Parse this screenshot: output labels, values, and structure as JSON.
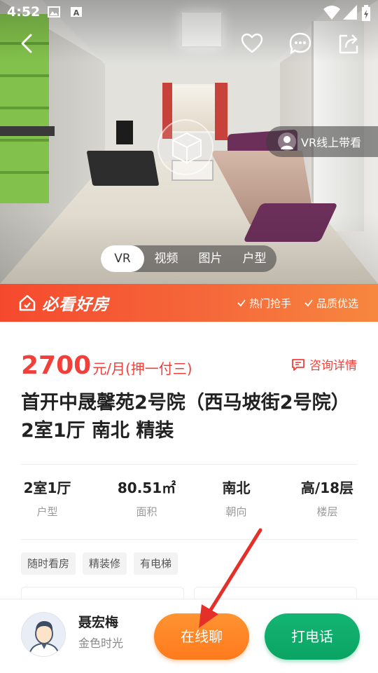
{
  "status_bar": {
    "time": "4:52",
    "icons": [
      "gallery-icon",
      "a-icon",
      "wifi-icon",
      "signal-icon",
      "battery-icon"
    ]
  },
  "hero": {
    "nav_icons": [
      "back-icon",
      "heart-icon",
      "message-icon",
      "share-icon"
    ],
    "vr_guide_label": "VR线上带看",
    "media_tabs": [
      {
        "label": "VR",
        "active": true
      },
      {
        "label": "视频",
        "active": false
      },
      {
        "label": "图片",
        "active": false
      },
      {
        "label": "户型",
        "active": false
      }
    ]
  },
  "banner": {
    "title": "必看好房",
    "tags": [
      "热门抢手",
      "品质优选"
    ],
    "colors": {
      "from": "#f5492e",
      "to": "#f7873f"
    }
  },
  "listing": {
    "price": "2700",
    "price_unit": "元/月(押一付三)",
    "consult_label": "咨询详情",
    "title": "首开中晟馨苑2号院（西马坡街2号院） 2室1厅 南北 精装",
    "stats": [
      {
        "value": "2室1厅",
        "label": "户型"
      },
      {
        "value": "80.51㎡",
        "label": "面积"
      },
      {
        "value": "南北",
        "label": "朝向"
      },
      {
        "value": "高/18层",
        "label": "楼层"
      }
    ],
    "chips": [
      "随时看房",
      "精装修",
      "有电梯"
    ],
    "price_color": "#f23f3a"
  },
  "agent": {
    "name": "聂宏梅",
    "title": "金色时光",
    "chat_label": "在线聊",
    "call_label": "打电话",
    "chat_color": "#ff7a1c",
    "call_color": "#0aa464"
  }
}
